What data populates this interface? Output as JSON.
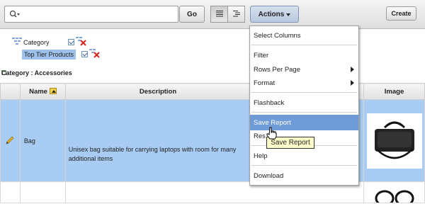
{
  "toolbar": {
    "search": {
      "value": "",
      "placeholder": ""
    },
    "go_label": "Go",
    "actions_label": "Actions",
    "create_label": "Create"
  },
  "filters": {
    "items": [
      {
        "label": "Category",
        "enabled": true
      },
      {
        "label": "Top Tier Products",
        "enabled": true
      }
    ]
  },
  "group_heading": "Category : Accessories",
  "table": {
    "columns": [
      "Name",
      "Description",
      "Image"
    ],
    "rows": [
      {
        "name": "Bag",
        "description": "Unisex bag suitable for carrying laptops with room for many additional items"
      }
    ]
  },
  "actions_menu": {
    "items": [
      {
        "label": "Select Columns",
        "submenu": false
      },
      {
        "label": "Filter",
        "submenu": false
      },
      {
        "label": "Rows Per Page",
        "submenu": true
      },
      {
        "label": "Format",
        "submenu": true
      },
      {
        "label": "Flashback",
        "submenu": false
      },
      {
        "label": "Save Report",
        "submenu": false
      },
      {
        "label": "Res",
        "submenu": false
      },
      {
        "label": "Help",
        "submenu": false
      },
      {
        "label": "Download",
        "submenu": false
      }
    ],
    "highlighted": "Save Report"
  },
  "tooltip": "Save Report",
  "colors": {
    "selected_row": "#a8ccf3",
    "menu_hover": "#6f9bd6",
    "tooltip_bg": "#ffffcc"
  }
}
